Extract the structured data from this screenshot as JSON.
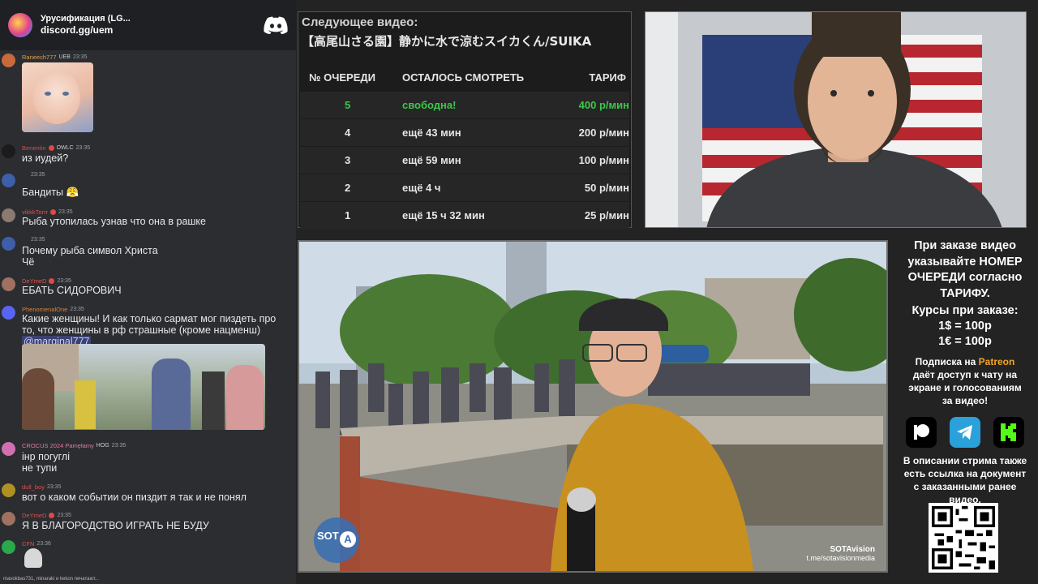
{
  "chat": {
    "server_name": "Урусификация (LG...",
    "server_link": "discord.gg/uem",
    "messages": [
      {
        "user": "Raneech777",
        "badges": "UEB",
        "time": "23:35",
        "text": "",
        "color": "#e0a040"
      },
      {
        "user": "Benentin",
        "badges": "OWLC",
        "time": "23:35",
        "text": "из иудей?",
        "color": "#d05050"
      },
      {
        "user": "",
        "badges": "",
        "time": "23:35",
        "text": "Бандиты 😤",
        "color": "#ccc"
      },
      {
        "user": "vikkkTorrr",
        "badges": "",
        "time": "23:35",
        "text": "Рыба утопилась узнав что она в рашке",
        "color": "#e05050"
      },
      {
        "user": "",
        "badges": "",
        "time": "23:35",
        "text": "Почему рыба символ Христа",
        "text2": "Чё",
        "color": "#ccc"
      },
      {
        "user": "DeYmeD",
        "badges": "",
        "time": "23:35",
        "text": "ЕБАТЬ СИДОРОВИЧ",
        "color": "#e05050"
      },
      {
        "user": "PhenomenalOne",
        "badges": "",
        "time": "23:35",
        "text": "Какие женщины! И как только сармат мог пиздеть про",
        "text2": "то, что женщины в рф страшные (кроме нацменш)",
        "mention": "@marginal777",
        "color": "#e08030"
      },
      {
        "user": "CROCUS 2024 Pamęłamy",
        "badges": "HOG",
        "time": "23:35",
        "text": "інр погуглі",
        "text2": "не тупи",
        "color": "#e07aa0"
      },
      {
        "user": "dull_boy",
        "badges": "",
        "time": "23:35",
        "text": "вот о каком событии он пиздит я так и не понял",
        "color": "#e05050"
      },
      {
        "user": "DeYmeD",
        "badges": "",
        "time": "23:35",
        "text": "Я В БЛАГОРОДСТВО ИГРАТЬ НЕ БУДУ",
        "color": "#e05050"
      },
      {
        "user": "CFN",
        "badges": "",
        "time": "23:36",
        "text": "",
        "color": "#e05050"
      }
    ],
    "typing": "mavokbas731, minaraki и kekon печатают..."
  },
  "queue": {
    "next_label": "Следующее видео:",
    "next_video": "【高尾山さる園】静かに水で涼むスイカくん/SUIKA",
    "headers": {
      "num": "№ ОЧЕРЕДИ",
      "left": "ОСТАЛОСЬ СМОТРЕТЬ",
      "rate": "ТАРИФ"
    },
    "rows": [
      {
        "num": "5",
        "left": "свободна!",
        "rate": "400 р/мин"
      },
      {
        "num": "4",
        "left": "ещё 43 мин",
        "rate": "200 р/мин"
      },
      {
        "num": "3",
        "left": "ещё 59 мин",
        "rate": "100 р/мин"
      },
      {
        "num": "2",
        "left": "ещё 4 ч",
        "rate": "50 р/мин"
      },
      {
        "num": "1",
        "left": "ещё 15 ч 32 мин",
        "rate": "25 р/мин"
      }
    ]
  },
  "video": {
    "logo_text": "SOT",
    "logo_a": "A",
    "watermark_name": "SOTAvision",
    "watermark_link": "t.me/sotavisionmedia"
  },
  "info": {
    "order_1": "При заказе видео",
    "order_2": "указывайте НОМЕР",
    "order_3": "ОЧЕРЕДИ согласно",
    "order_4": "ТАРИФУ.",
    "rates_title": "Курсы при заказе:",
    "rate_usd": "1$ = 100р",
    "rate_eur": "1€ = 100р",
    "sub_1": "Подписка на ",
    "sub_patreon": "Patreon",
    "sub_2": "даёт доступ к чату на",
    "sub_3": "экране и голосованиям",
    "sub_4": "за видео!",
    "desc_1": "В описании стрима также",
    "desc_2": "есть ссылка на документ",
    "desc_3": "с заказанными ранее",
    "desc_4": "видео."
  },
  "colors": {
    "active_row": "#3cc84a",
    "patreon": "#f5a623",
    "telegram": "#2aa1da",
    "kick": "#53fc18",
    "discord": "#ffffff"
  }
}
